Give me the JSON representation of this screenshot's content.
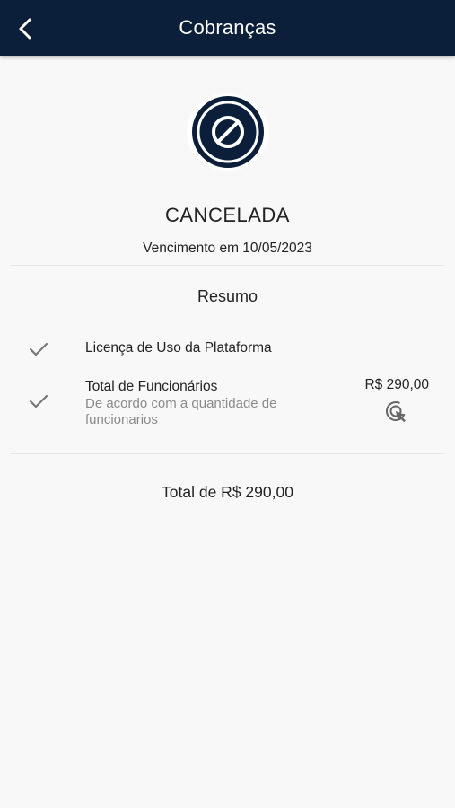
{
  "header": {
    "title": "Cobranças",
    "back_icon": "chevron-left-icon",
    "background": "#0b1f3a"
  },
  "status": {
    "icon": "cancel-ban-icon",
    "label": "CANCELADA",
    "due_date_text": "Vencimento em 10/05/2023"
  },
  "summary": {
    "title": "Resumo",
    "items": [
      {
        "title": "Licença de Uso da Plataforma",
        "subtitle": "",
        "price": "",
        "check_icon": "check-icon"
      },
      {
        "title": "Total de Funcionários",
        "subtitle": "De acordo com a quantidade de funcionarios",
        "price": "R$ 290,00",
        "check_icon": "check-icon",
        "action_icon": "pointer-click-icon"
      }
    ]
  },
  "total_text": "Total de R$ 290,00",
  "colors": {
    "accent": "#0b1f3a",
    "text": "#222222",
    "muted": "#8a8a8a"
  }
}
